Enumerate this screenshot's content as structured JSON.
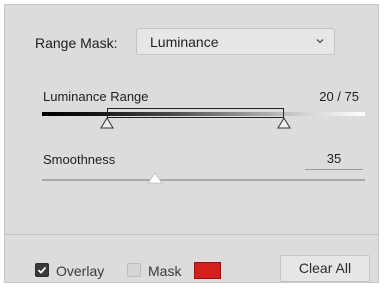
{
  "range_mask": {
    "label": "Range Mask:",
    "selected": "Luminance",
    "icon": "chevron-down-icon"
  },
  "luminance_range": {
    "label": "Luminance Range",
    "value_text": "20 / 75",
    "low": 20,
    "high": 75,
    "scale_max": 100
  },
  "smoothness": {
    "label": "Smoothness",
    "value": "35",
    "level": 35,
    "scale_max": 100
  },
  "bottom": {
    "overlay_label": "Overlay",
    "overlay_checked": true,
    "mask_label": "Mask",
    "mask_checked": false,
    "mask_color": "#d41f1f",
    "clear_all_label": "Clear All"
  }
}
